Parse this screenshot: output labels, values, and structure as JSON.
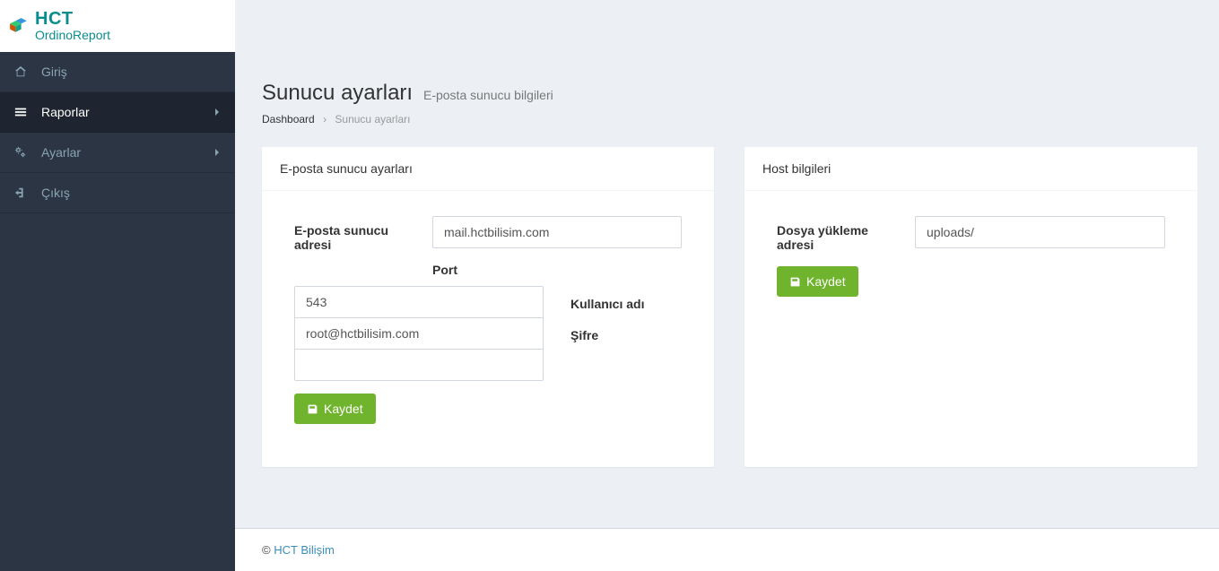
{
  "brand": {
    "title": "HCT",
    "subtitle": "OrdinoReport"
  },
  "sidebar": {
    "items": [
      {
        "label": "Giriş"
      },
      {
        "label": "Raporlar"
      },
      {
        "label": "Ayarlar"
      },
      {
        "label": "Çıkış"
      }
    ]
  },
  "page": {
    "title": "Sunucu ayarları",
    "subtitle": "E-posta sunucu bilgileri"
  },
  "breadcrumb": {
    "root": "Dashboard",
    "current": "Sunucu ayarları"
  },
  "panel_email": {
    "title": "E-posta sunucu ayarları",
    "label_address": "E-posta sunucu adresi",
    "value_address": "mail.hctbilisim.com",
    "label_port": "Port",
    "value_port": "543",
    "label_user": "Kullanıcı adı",
    "value_user": "root@hctbilisim.com",
    "label_pass": "Şifre",
    "value_pass": "",
    "save_label": "Kaydet"
  },
  "panel_host": {
    "title": "Host bilgileri",
    "label_upload": "Dosya yükleme adresi",
    "value_upload": "uploads/",
    "save_label": "Kaydet"
  },
  "footer": {
    "copyright": "©",
    "link": "HCT Bilişim"
  }
}
